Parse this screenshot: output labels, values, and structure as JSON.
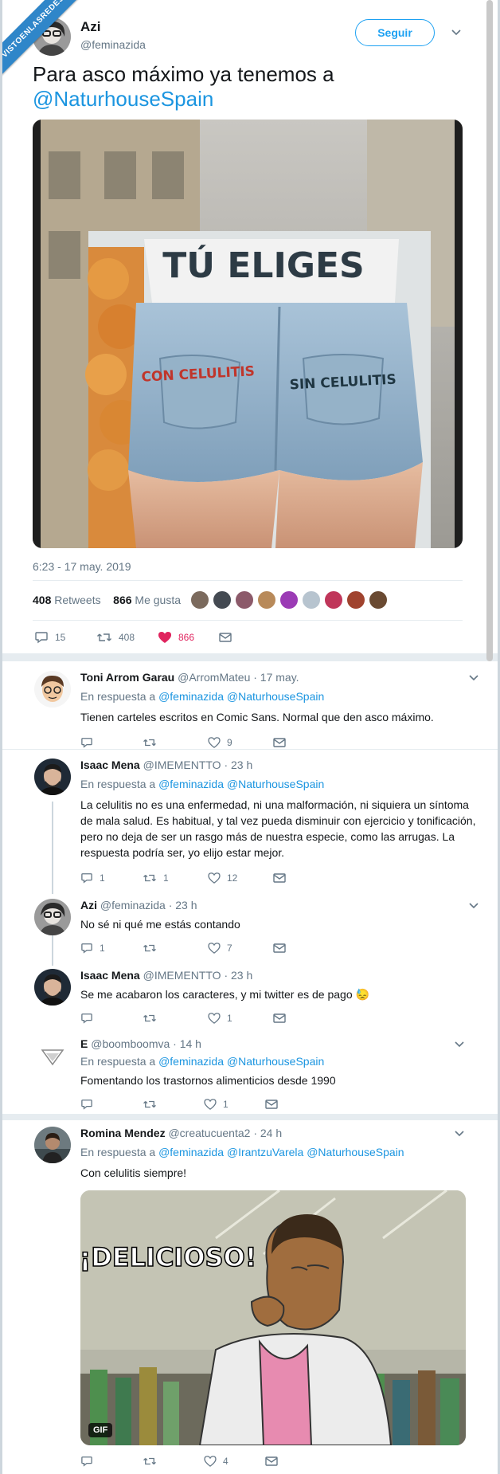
{
  "watermark": "VISTOENLASREDES",
  "main": {
    "name": "Azi",
    "handle": "@feminazida",
    "follow_label": "Seguir",
    "text_line1": "Para asco máximo ya tenemos a",
    "text_mention": "@NaturhouseSpain",
    "photo_text": {
      "headline": "TÚ ELIGES",
      "left_pocket": "CON CELULITIS",
      "right_pocket": "SIN CELULITIS"
    },
    "timestamp": "6:23 - 17 may. 2019",
    "retweets_count": "408",
    "retweets_label": "Retweets",
    "likes_count": "866",
    "likes_label": "Me gusta",
    "actions": {
      "replies": "15",
      "retweets": "408",
      "likes": "866"
    }
  },
  "replies": [
    {
      "name": "Toni Arrom Garau",
      "handle": "@ArromMateu",
      "time": "· 17 may.",
      "reply_prefix": "En respuesta a",
      "reply_to": "@feminazida @NaturhouseSpain",
      "text": "Tienen carteles escritos en Comic Sans. Normal que den asco máximo.",
      "replies": "",
      "retweets": "",
      "likes": "9"
    },
    {
      "name": "Isaac Mena",
      "handle": "@IMEMENTTO",
      "time": "· 23 h",
      "reply_prefix": "En respuesta a",
      "reply_to": "@feminazida @NaturhouseSpain",
      "text": "La celulitis no es una enfermedad, ni una malformación, ni siquiera un síntoma de mala salud. Es habitual, y tal vez pueda disminuir con ejercicio y tonificación, pero no deja de ser un rasgo más de nuestra especie, como las arrugas. La respuesta podría ser, yo elijo estar mejor.",
      "replies": "1",
      "retweets": "1",
      "likes": "12"
    },
    {
      "name": "Azi",
      "handle": "@feminazida",
      "time": "· 23 h",
      "text": "No sé ni qué me estás contando",
      "replies": "1",
      "retweets": "",
      "likes": "7"
    },
    {
      "name": "Isaac Mena",
      "handle": "@IMEMENTTO",
      "time": "· 23 h",
      "text": "Se me acabaron los caracteres, y mi twitter es de pago 😓",
      "replies": "",
      "retweets": "",
      "likes": "1"
    },
    {
      "name": "E",
      "handle": "@boomboomva",
      "time": "· 14 h",
      "reply_prefix": "En respuesta a",
      "reply_to": "@feminazida @NaturhouseSpain",
      "text": "Fomentando los trastornos alimenticios desde 1990",
      "replies": "",
      "retweets": "",
      "likes": "1"
    },
    {
      "name": "Romina Mendez",
      "handle": "@creatucuenta2",
      "time": "· 24 h",
      "reply_prefix": "En respuesta a",
      "reply_to": "@feminazida @IrantzuVarela @NaturhouseSpain",
      "text": "Con celulitis siempre!",
      "gif_caption": "¡DELICIOSO!",
      "gif_badge": "GIF",
      "replies": "",
      "retweets": "",
      "likes": "4"
    }
  ]
}
